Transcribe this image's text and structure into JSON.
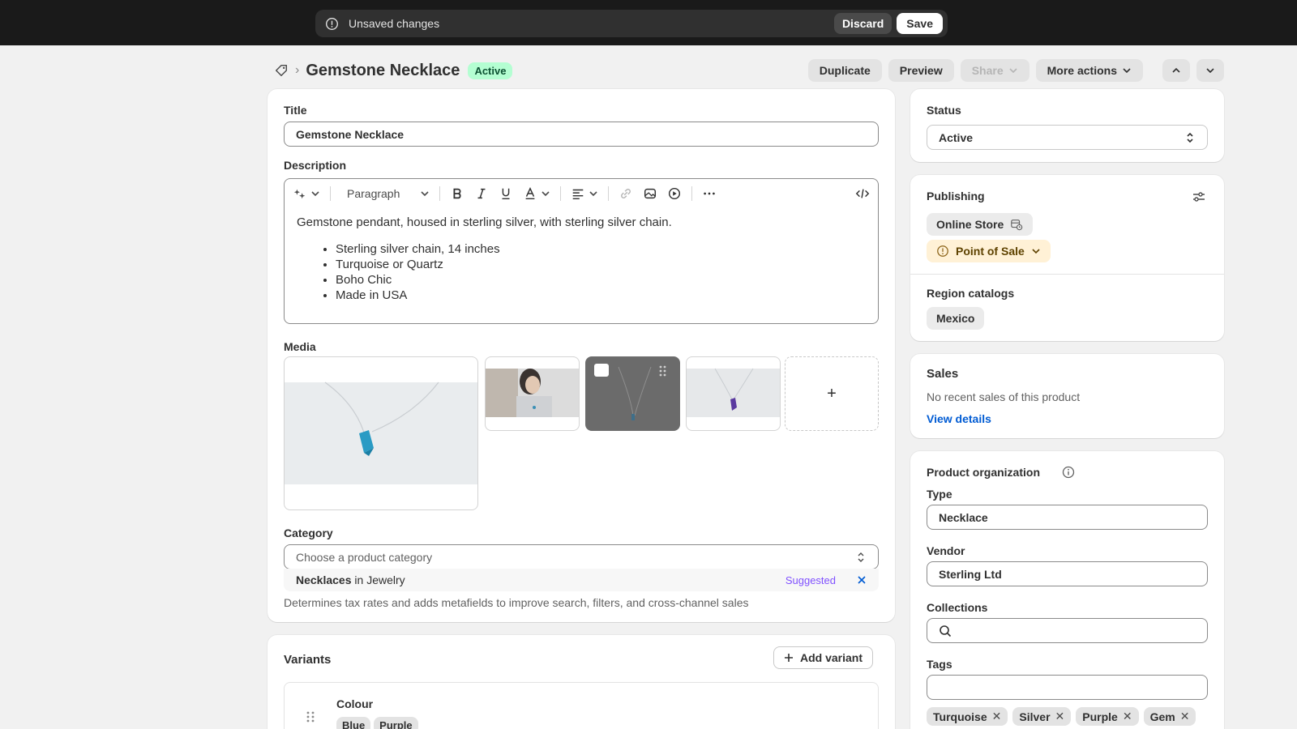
{
  "topbar": {
    "message": "Unsaved changes",
    "discard_label": "Discard",
    "save_label": "Save"
  },
  "header": {
    "title": "Gemstone Necklace",
    "status_badge": "Active",
    "actions": {
      "duplicate": "Duplicate",
      "preview": "Preview",
      "share": "Share",
      "more_actions": "More actions"
    }
  },
  "product": {
    "title_label": "Title",
    "title_value": "Gemstone Necklace",
    "description_label": "Description",
    "editor_format": "Paragraph",
    "description_text": "Gemstone pendant, housed in sterling silver, with sterling silver chain.",
    "description_bullets": [
      "Sterling silver chain, 14 inches",
      "Turquoise or Quartz",
      "Boho Chic",
      "Made in USA"
    ],
    "media_label": "Media",
    "media_add": "+",
    "category_label": "Category",
    "category_placeholder": "Choose a product category",
    "category_suggestion_bold": "Necklaces",
    "category_suggestion_rest": " in Jewelry",
    "category_suggested_tag": "Suggested",
    "category_help": "Determines tax rates and adds metafields to improve search, filters, and cross-channel sales"
  },
  "variants": {
    "heading": "Variants",
    "add_label": "Add variant",
    "option_name": "Colour",
    "option_values": [
      "Blue",
      "Purple"
    ]
  },
  "status": {
    "label": "Status",
    "value": "Active"
  },
  "publishing": {
    "heading": "Publishing",
    "channels": [
      "Online Store",
      "Point of Sale"
    ],
    "region_label": "Region catalogs",
    "region_value": "Mexico"
  },
  "sales": {
    "heading": "Sales",
    "text": "No recent sales of this product",
    "link": "View details"
  },
  "organization": {
    "heading": "Product organization",
    "type_label": "Type",
    "type_value": "Necklace",
    "vendor_label": "Vendor",
    "vendor_value": "Sterling Ltd",
    "collections_label": "Collections",
    "collections_value": "",
    "tags_label": "Tags",
    "tags_value": "",
    "tags": [
      "Turquoise",
      "Silver",
      "Purple",
      "Gem"
    ]
  },
  "colors": {
    "topbar_bg": "#1a1a1a",
    "active_badge_bg": "#b4fed2",
    "pos_bg": "#fff1d6",
    "link": "#005bd3",
    "suggested": "#8051ff"
  }
}
